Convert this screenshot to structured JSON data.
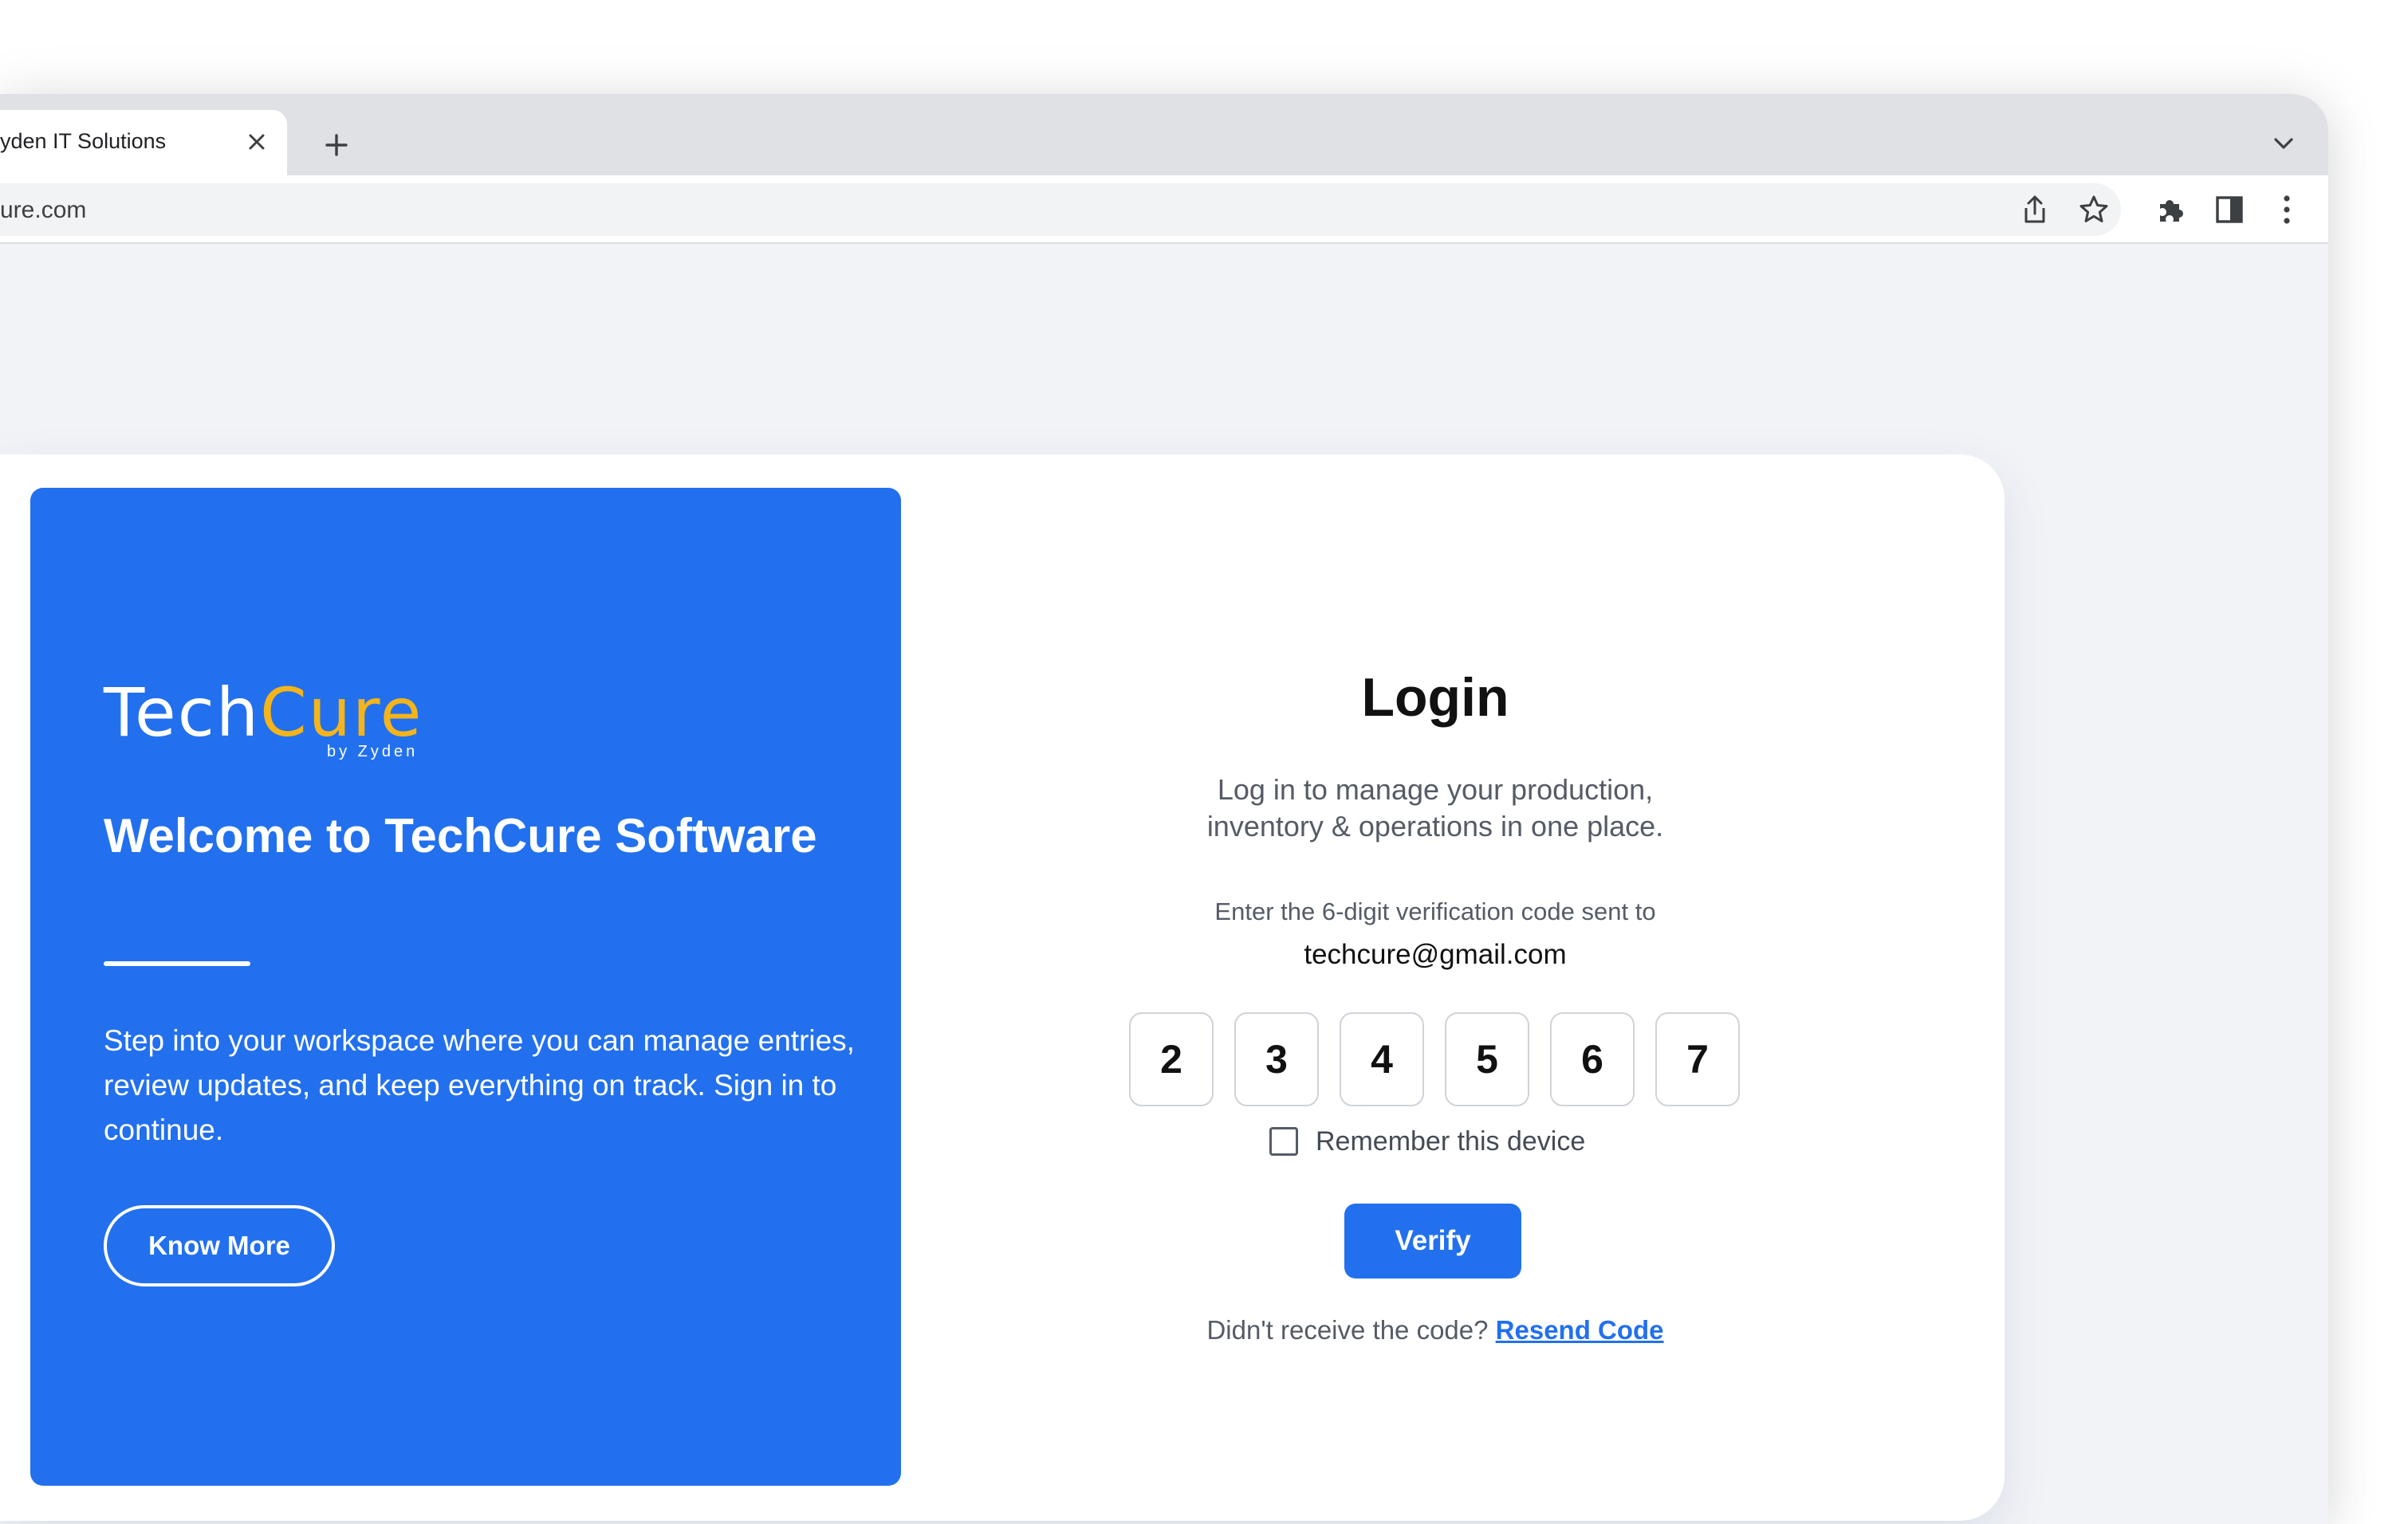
{
  "browser": {
    "tab_title": "yden IT Solutions",
    "url": "ure.com",
    "icons": {
      "tab_close": "close-icon",
      "new_tab": "plus-icon",
      "tab_list": "chevron-down-icon",
      "share": "share-icon",
      "bookmark": "star-icon",
      "extensions": "puzzle-icon",
      "side_panel": "side-panel-icon",
      "menu": "kebab-menu-icon"
    }
  },
  "brand": {
    "logo_part1": "Tech",
    "logo_part2": "Cure",
    "logo_byline": "by Zyden",
    "colors": {
      "primary_blue": "#2270ee",
      "logo_accent": "#f4b41a"
    }
  },
  "welcome_panel": {
    "heading": "Welcome to TechCure Software",
    "description": "Step into your workspace where you can manage entries, review updates, and keep everything on track. Sign in to continue.",
    "know_more_label": "Know More"
  },
  "login": {
    "title": "Login",
    "subtitle": "Log in to manage your production, inventory & operations in one place.",
    "code_hint": "Enter the 6-digit verification code sent to",
    "email": "techcure@gmail.com",
    "otp_digits": [
      "2",
      "3",
      "4",
      "5",
      "6",
      "7"
    ],
    "remember_label": "Remember this device",
    "remember_checked": false,
    "verify_label": "Verify",
    "resend_prompt": "Didn't receive the code?",
    "resend_link": "Resend Code"
  }
}
